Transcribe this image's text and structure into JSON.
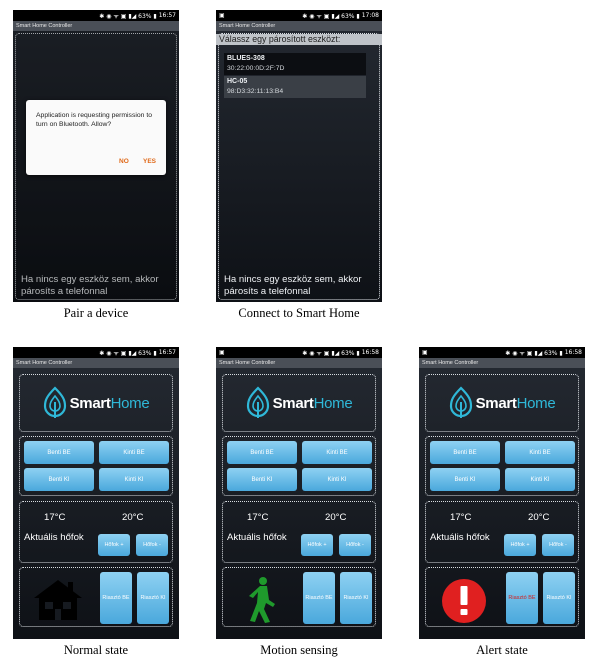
{
  "app_title": "Smart Home Controller",
  "status_icons": "✱ ◉ ᯤ ▣ ▮◢ 63% ▮",
  "phones": {
    "pair": {
      "time": "16:57",
      "dialog_text": "Application is requesting permission to turn on Bluetooth. Allow?",
      "no_label": "NO",
      "yes_label": "YES",
      "bottom_text": "Ha nincs egy eszköz sem, akkor párosíts a telefonnal"
    },
    "connect": {
      "time": "17:08",
      "list_header": "Válassz egy párosított eszközt:",
      "devices": [
        {
          "name": "BLUES-308",
          "mac": "30:22:00:0D:2F:7D"
        },
        {
          "name": "HC-05",
          "mac": "98:D3:32:11:13:B4"
        }
      ],
      "bottom_text": "Ha nincs egy eszköz sem, akkor párosíts a telefonnal"
    },
    "normal": {
      "time": "16:57"
    },
    "motion": {
      "time": "16:58"
    },
    "alert": {
      "time": "16:58"
    }
  },
  "panel": {
    "logo_smart": "Smart",
    "logo_home": "Home",
    "buttons": {
      "benti_be": "Benti BE",
      "kinti_be": "Kinti BE",
      "benti_ki": "Benti KI",
      "kinti_ki": "Kinti KI"
    },
    "temp_inside": "17°C",
    "temp_outside": "20°C",
    "temp_label": "Aktuális hőfok",
    "temp_plus": "Hőfok +",
    "temp_minus": "Hőfok -",
    "alarm_on": "Riasztó BE",
    "alarm_off": "Riasztó KI"
  },
  "captions": {
    "pair": "Pair a device",
    "connect": "Connect to Smart Home",
    "normal": "Normal state",
    "motion": "Motion sensing",
    "alert": "Alert state"
  },
  "colors": {
    "accent_blue": "#4aa8dc",
    "logo_cyan": "#2fb8d8",
    "alert_red": "#e02020",
    "motion_green": "#1f9a2c",
    "dialog_action": "#e06a1a"
  }
}
